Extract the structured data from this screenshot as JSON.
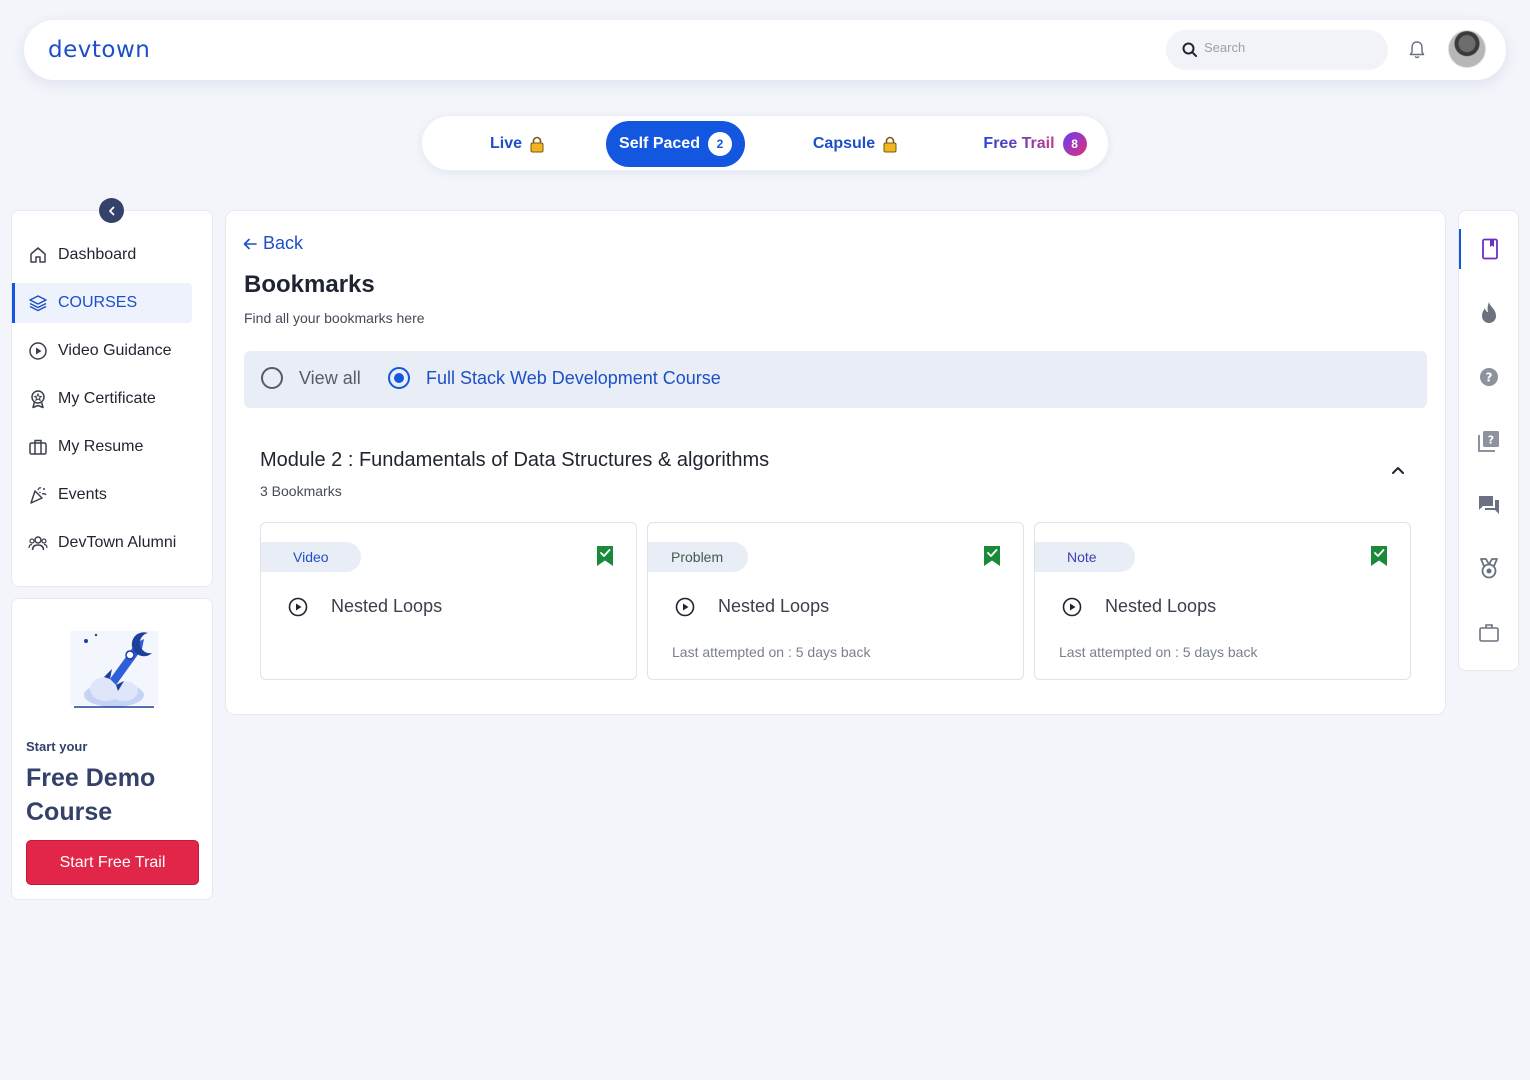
{
  "app": {
    "logo": "devtown"
  },
  "header": {
    "search_placeholder": "Search"
  },
  "tabs": [
    {
      "label": "Live"
    },
    {
      "label": "Self Paced",
      "count": "2"
    },
    {
      "label": "Capsule"
    },
    {
      "label": "Free Trail",
      "count": "8"
    }
  ],
  "sidebar": {
    "items": [
      {
        "label": "Dashboard"
      },
      {
        "label": "COURSES"
      },
      {
        "label": "Video Guidance"
      },
      {
        "label": "My Certificate"
      },
      {
        "label": "My Resume"
      },
      {
        "label": "Events"
      },
      {
        "label": "DevTown Alumni"
      }
    ]
  },
  "promo": {
    "small": "Start your",
    "big": "Free Demo Course",
    "button": "Start Free Trail"
  },
  "main": {
    "back": "Back",
    "title": "Bookmarks",
    "subtitle": "Find all your bookmarks here",
    "filters": [
      {
        "label": "View all",
        "checked": false
      },
      {
        "label": "Full Stack Web Development Course",
        "checked": true
      }
    ],
    "module": {
      "title": "Module 2 : Fundamentals of Data Structures & algorithms",
      "count": "3 Bookmarks"
    },
    "cards": [
      {
        "type": "Video",
        "title": "Nested Loops",
        "meta": ""
      },
      {
        "type": "Problem",
        "title": "Nested Loops",
        "meta": "Last attempted on : 5 days back"
      },
      {
        "type": "Note",
        "title": "Nested Loops",
        "meta": "Last attempted on : 5 days back"
      }
    ]
  },
  "rail": {
    "icons": [
      "bookmark-icon",
      "fire-icon",
      "help-icon",
      "quiz-icon",
      "chat-icon",
      "award-icon",
      "briefcase-icon"
    ]
  },
  "colors": {
    "primary": "#1357e0",
    "accent_red": "#e1264a",
    "bookmark_green": "#1a8a3a"
  }
}
